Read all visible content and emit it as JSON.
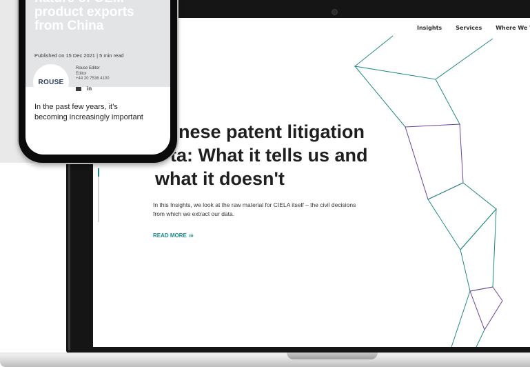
{
  "site": {
    "nav": [
      {
        "label": "Insights"
      },
      {
        "label": "Services"
      },
      {
        "label": "Where We Wo"
      }
    ],
    "hero": {
      "headline_lines": [
        "nese patent litigation",
        "ta: What it tells us and",
        "what it doesn't"
      ],
      "intro": "In this Insights, we look at the raw material for CIELA itself – the civil decisions from which we extract our data.",
      "read_more": "READ MORE",
      "read_more_arrows": "›››"
    },
    "scroll_progress": 0.15
  },
  "phone": {
    "title_lines": [
      "nature of OEM",
      "product exports",
      "from China"
    ],
    "meta": "Published on 15 Dec 2021 | 5 min read",
    "logo_text": "ROUSE",
    "author": {
      "name": "Rouse Editor",
      "role": "Editor",
      "phone": "+44 20 7536 4100"
    },
    "social_linkedin": "in",
    "body_lines": [
      "In the past few years, it’s",
      "becoming increasingly important"
    ]
  },
  "colors": {
    "accent": "#1a8a8e",
    "line_green": "#1d8c83",
    "line_purple": "#6b3fa0"
  }
}
